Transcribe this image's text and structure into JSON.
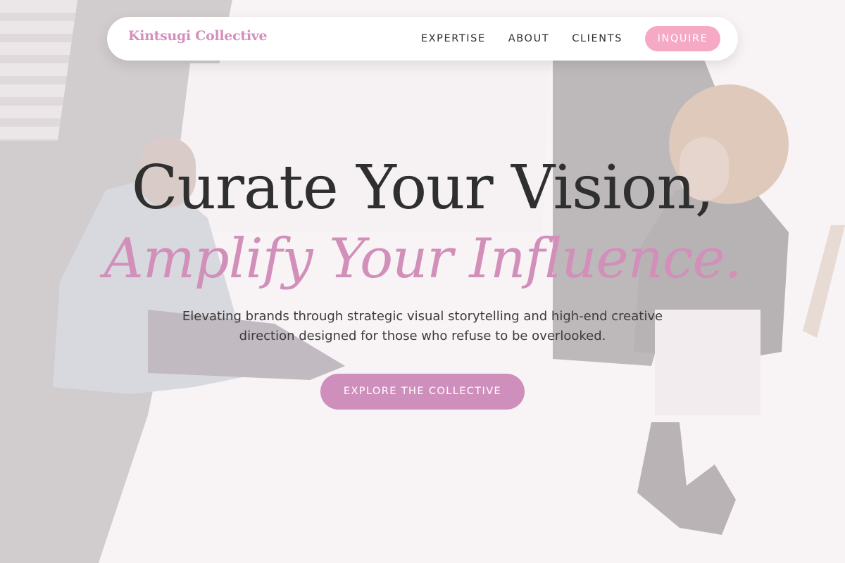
{
  "nav": {
    "brand": "Kintsugi Collective",
    "links": [
      "EXPERTISE",
      "ABOUT",
      "CLIENTS"
    ],
    "cta_label": "INQUIRE"
  },
  "hero": {
    "headline_line1": "Curate Your Vision,",
    "headline_line2": "Amplify Your Influence.",
    "subtitle": "Elevating brands through strategic visual storytelling and high-end creative direction designed for those who refuse to be overlooked.",
    "cta_label": "EXPLORE THE COLLECTIVE"
  },
  "colors": {
    "accent_pink": "#d18fba",
    "cta_nav_pink": "#f6a9c4",
    "heading_dark": "#2f2f2f",
    "nav_background": "#ffffff"
  },
  "background": {
    "description_icon": "photo-background"
  }
}
